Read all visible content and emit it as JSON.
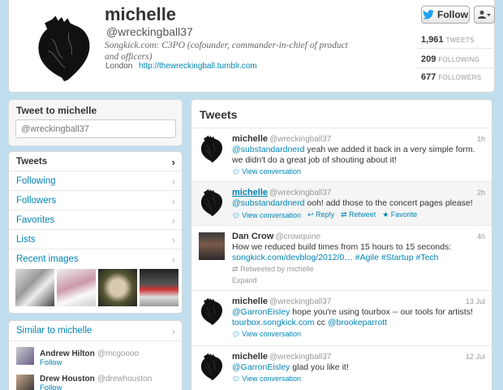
{
  "profile": {
    "name": "michelle",
    "handle": "@wreckingball37",
    "bio": "Songkick.com: C3PO (cofounder, commander-in-chief of product and officers)",
    "location": "London",
    "url": "http://thewreckingball.tumblr.com",
    "follow_label": "Follow",
    "stats": [
      {
        "value": "1,961",
        "label": "TWEETS"
      },
      {
        "value": "209",
        "label": "FOLLOWING"
      },
      {
        "value": "677",
        "label": "FOLLOWERS"
      }
    ]
  },
  "tweet_box": {
    "title": "Tweet to michelle",
    "placeholder": "@wreckingball37"
  },
  "nav": {
    "items": [
      "Tweets",
      "Following",
      "Followers",
      "Favorites",
      "Lists",
      "Recent images"
    ]
  },
  "similar": {
    "title": "Similar to michelle",
    "users": [
      {
        "name": "Andrew Hilton",
        "handle": "@mcgoooo",
        "action": "Follow"
      },
      {
        "name": "Drew Houston",
        "handle": "@drewhouston",
        "action": "Follow"
      }
    ]
  },
  "tweets": {
    "title": "Tweets",
    "items": [
      {
        "name": "michelle",
        "handle": "@wreckingball37",
        "time": "1h",
        "mention": "@substandardnerd",
        "text": " yeah we added it back in a very simple form. we didn't do a great job of shouting about it!",
        "view": "View conversation"
      },
      {
        "name": "michelle",
        "handle": "@wreckingball37",
        "time": "2h",
        "mention": "@substandardnerd",
        "text": " ooh! add those to the concert pages please!",
        "view": "View conversation",
        "reply": "Reply",
        "retweet": "Retweet",
        "favorite": "Favorite"
      },
      {
        "name": "Dan Crow",
        "handle": "@crowquine",
        "time": "4h",
        "text": "How we reduced build times from 15 hours to 15 seconds:",
        "link": "songkick.com/devblog/2012/0…",
        "tags": "#Agile #Startup #Tech",
        "retweeted_by": "Retweeted by michelle",
        "expand": "Expand"
      },
      {
        "name": "michelle",
        "handle": "@wreckingball37",
        "time": "13 Jul",
        "mention": "@GarronEisley",
        "text": " hope you're using tourbox -- our tools for artists!",
        "link": "tourbox.songkick.com",
        "text2": " cc ",
        "mention2": "@brookeparrott",
        "view": "View conversation"
      },
      {
        "name": "michelle",
        "handle": "@wreckingball37",
        "time": "12 Jul",
        "mention": "@GarronEisley",
        "text": " glad you like it!",
        "view": "View conversation"
      }
    ]
  },
  "colors": {
    "link": "#0084b4",
    "background": "#c0deed",
    "twitter_blue": "#1da1f2"
  }
}
